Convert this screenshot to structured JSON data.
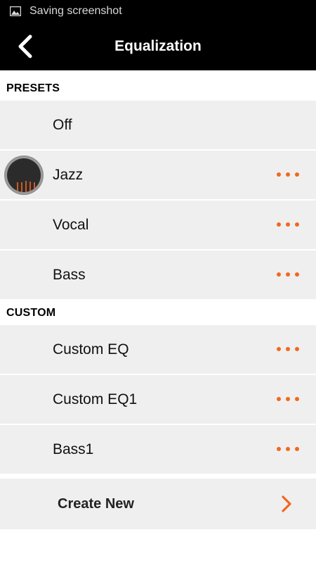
{
  "status_bar": {
    "icon": "image-icon",
    "text": "Saving screenshot"
  },
  "app_bar": {
    "back_icon": "chevron-left-icon",
    "title": "Equalization"
  },
  "presets": {
    "header": "PRESETS",
    "items": [
      {
        "label": "Off",
        "selected": false,
        "has_more": false
      },
      {
        "label": "Jazz",
        "selected": true,
        "has_more": true
      },
      {
        "label": "Vocal",
        "selected": false,
        "has_more": true
      },
      {
        "label": "Bass",
        "selected": false,
        "has_more": true
      }
    ]
  },
  "custom": {
    "header": "CUSTOM",
    "items": [
      {
        "label": "Custom EQ",
        "has_more": true
      },
      {
        "label": "Custom EQ1",
        "has_more": true
      },
      {
        "label": "Bass1",
        "has_more": true
      }
    ]
  },
  "create_new": {
    "label": "Create New",
    "icon": "chevron-right-icon"
  },
  "colors": {
    "accent": "#f26722",
    "row_background": "#efefef",
    "bar_background": "#000000"
  }
}
